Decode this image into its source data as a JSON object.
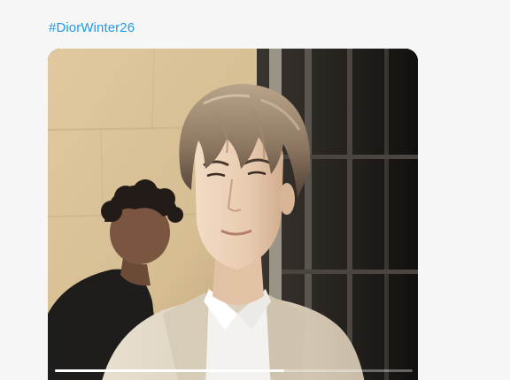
{
  "post": {
    "hashtag": "#DiorWinter26",
    "link_color": "#1d9bf0"
  },
  "video": {
    "icon": "video-frame",
    "progress_percent": 64
  }
}
